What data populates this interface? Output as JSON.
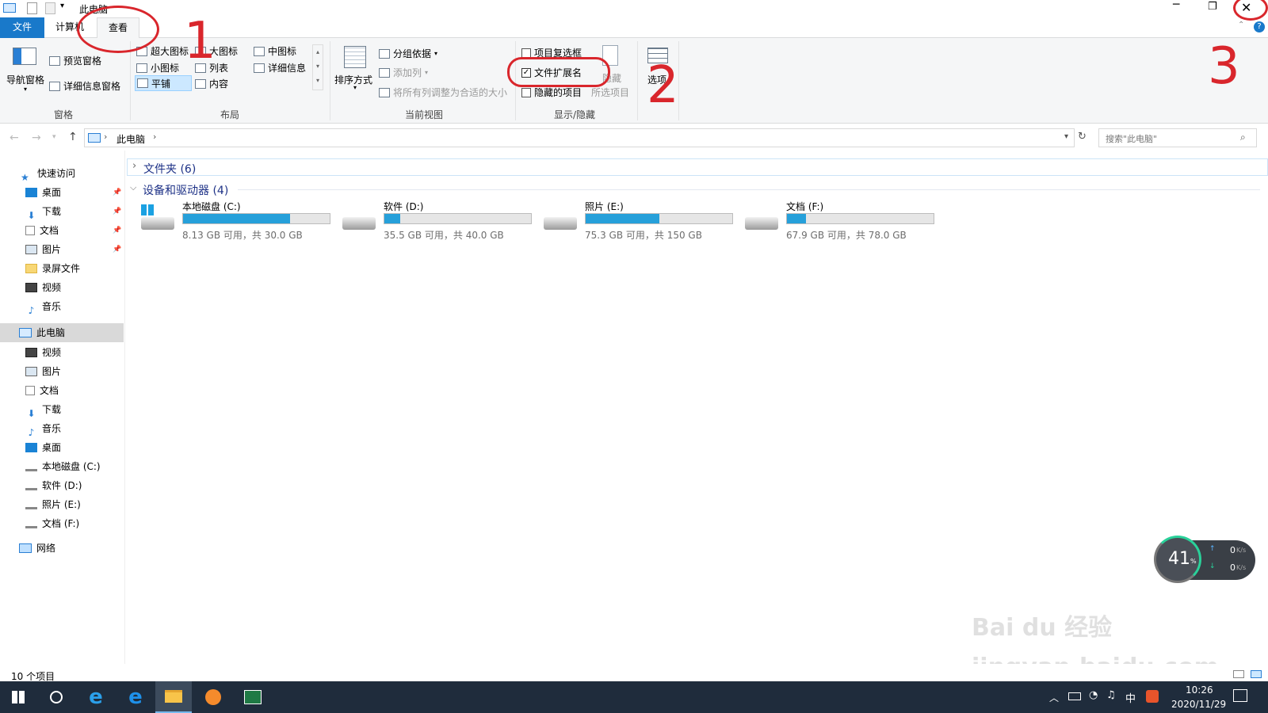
{
  "window": {
    "title": "此电脑"
  },
  "tabs": [
    {
      "label": "文件"
    },
    {
      "label": "计算机"
    },
    {
      "label": "查看"
    }
  ],
  "ribbon": {
    "panes": {
      "nav": "导航窗格",
      "preview": "预览窗格",
      "details": "详细信息窗格",
      "label": "窗格"
    },
    "layout": {
      "items": [
        "超大图标",
        "大图标",
        "中图标",
        "小图标",
        "列表",
        "详细信息",
        "平铺",
        "内容"
      ],
      "label": "布局"
    },
    "view": {
      "sort": "排序方式",
      "group": "分组依据",
      "add_col": "添加列",
      "fit": "将所有列调整为合适的大小",
      "label": "当前视图"
    },
    "show": {
      "checkboxes": "项目复选框",
      "ext": "文件扩展名",
      "hidden": "隐藏的项目",
      "hide_sel_a": "隐藏",
      "hide_sel_b": "所选项目",
      "label": "显示/隐藏",
      "ext_checked": true
    },
    "options": "选项"
  },
  "address": {
    "path": "此电脑",
    "search_placeholder": "搜索\"此电脑\""
  },
  "nav": {
    "quick": "快速访问",
    "quick_items": [
      "桌面",
      "下载",
      "文档",
      "图片",
      "录屏文件",
      "视频",
      "音乐"
    ],
    "pc": "此电脑",
    "pc_items": [
      "视频",
      "图片",
      "文档",
      "下载",
      "音乐",
      "桌面",
      "本地磁盘 (C:)",
      "软件 (D:)",
      "照片 (E:)",
      "文档 (F:)"
    ],
    "network": "网络"
  },
  "content": {
    "folders_header": "文件夹 (6)",
    "devices_header": "设备和驱动器 (4)",
    "drives": [
      {
        "name": "本地磁盘 (C:)",
        "info": "8.13 GB 可用，共 30.0 GB",
        "used": 0.73
      },
      {
        "name": "软件 (D:)",
        "info": "35.5 GB 可用，共 40.0 GB",
        "used": 0.11
      },
      {
        "name": "照片 (E:)",
        "info": "75.3 GB 可用，共 150 GB",
        "used": 0.5
      },
      {
        "name": "文档 (F:)",
        "info": "67.9 GB 可用，共 78.0 GB",
        "used": 0.13
      }
    ]
  },
  "status": {
    "count": "10 个项目"
  },
  "widget": {
    "percent": "41",
    "unit": "%",
    "up": "0",
    "down": "0",
    "rate_unit": "K/s"
  },
  "taskbar": {
    "ime": "中",
    "time": "10:26",
    "date": "2020/11/29"
  },
  "annotations": [
    "1",
    "2",
    "3"
  ],
  "watermark": "Bai du 经验 jingyan.baidu.com",
  "colors": {
    "accent": "#26a0da",
    "file_tab": "#1979ca",
    "annotation": "#d9262c"
  }
}
